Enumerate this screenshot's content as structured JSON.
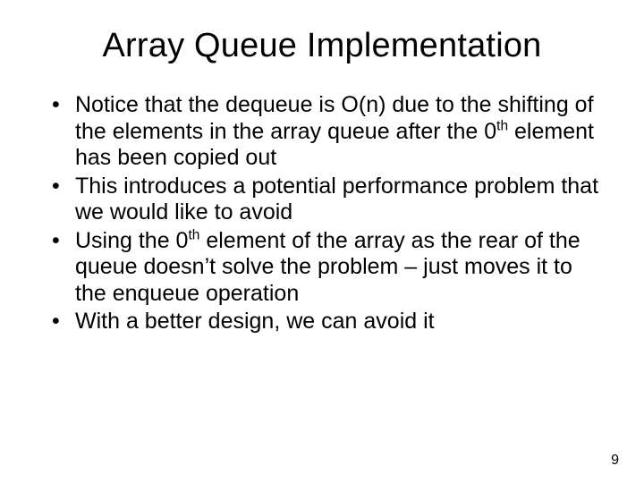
{
  "title": "Array Queue Implementation",
  "bullets": [
    {
      "pre": "Notice that the dequeue is O(n) due to the shifting of the elements in the array queue after the 0",
      "sup": "th",
      "post": " element has been copied out"
    },
    {
      "pre": "This introduces a potential performance problem that we would like to avoid",
      "sup": "",
      "post": ""
    },
    {
      "pre": "Using the 0",
      "sup": "th",
      "post": " element of the array as the rear of the queue doesn’t solve the problem – just moves it to the enqueue operation"
    },
    {
      "pre": "With a better design, we can avoid it",
      "sup": "",
      "post": ""
    }
  ],
  "page_number": "9"
}
